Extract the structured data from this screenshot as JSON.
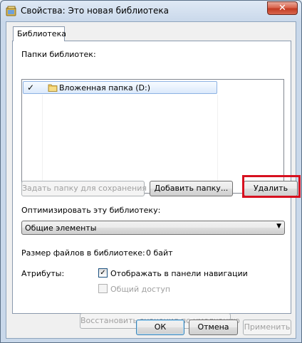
{
  "window": {
    "title": "Свойства: Это новая библиотека",
    "close_label": "✕"
  },
  "tabs": [
    {
      "label": "Библиотека"
    }
  ],
  "library": {
    "folders_label": "Папки библиотек:",
    "folders": [
      {
        "checked": "✓",
        "name": "Вложенная папка (D:)"
      }
    ],
    "set_save_folder_label": "Задать папку для сохранения",
    "add_folder_label": "Добавить папку...",
    "remove_label": "Удалить",
    "optimize_label": "Оптимизировать эту библиотеку:",
    "optimize_value": "Общие элементы",
    "size_label": "Размер файлов в библиотеке:",
    "size_value": "0 байт",
    "attributes_label": "Атрибуты:",
    "show_in_nav_label": "Отображать в панели навигации",
    "show_in_nav_checked": "✓",
    "shared_label": "Общий доступ",
    "restore_defaults_label": "Восстановить значения по умолчанию"
  },
  "footer": {
    "ok_label": "ОК",
    "cancel_label": "Отмена",
    "apply_label": "Применить"
  },
  "colors": {
    "highlight": "#d7101f",
    "selection": "#dbe9fb"
  }
}
